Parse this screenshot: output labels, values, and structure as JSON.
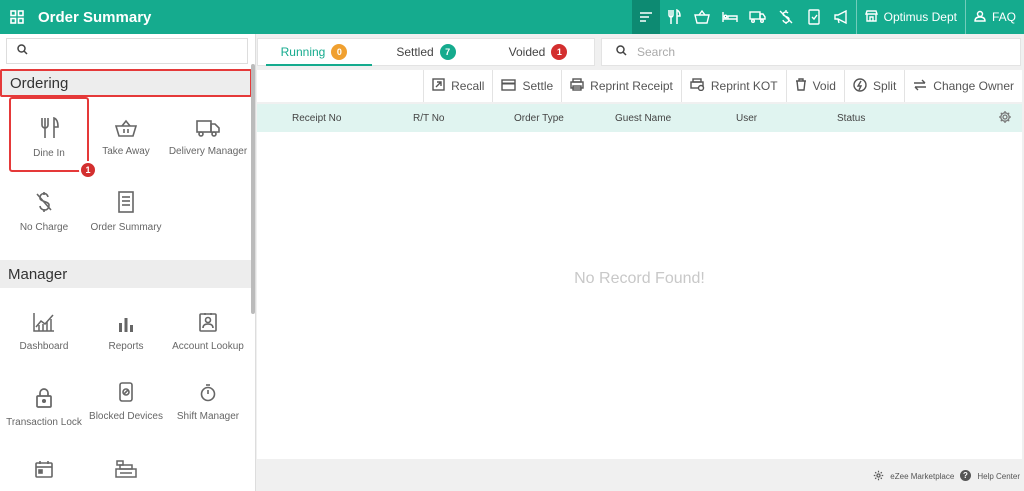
{
  "app": {
    "title": "Order Summary"
  },
  "topbar": {
    "icons": [
      "menu-lines-icon",
      "fork-knife-icon",
      "basket-icon",
      "bed-icon",
      "truck-icon",
      "no-charge-icon",
      "tablet-icon",
      "megaphone-icon"
    ],
    "department": "Optimus Dept",
    "faq": "FAQ"
  },
  "sidebar": {
    "search": {
      "placeholder": ""
    },
    "sections": [
      {
        "title": "Ordering",
        "tiles": [
          {
            "label": "Dine In",
            "icon": "fork-knife-icon",
            "badge": "1"
          },
          {
            "label": "Take Away",
            "icon": "basket-icon"
          },
          {
            "label": "Delivery Manager",
            "icon": "truck-icon"
          },
          {
            "label": "No Charge",
            "icon": "no-charge-icon"
          },
          {
            "label": "Order Summary",
            "icon": "receipt-icon"
          }
        ]
      },
      {
        "title": "Manager",
        "tiles": [
          {
            "label": "Dashboard",
            "icon": "chart-icon"
          },
          {
            "label": "Reports",
            "icon": "bar-chart-icon"
          },
          {
            "label": "Account Lookup",
            "icon": "contact-card-icon"
          },
          {
            "label": "Transaction Lock",
            "icon": "lock-icon"
          },
          {
            "label": "Blocked Devices",
            "icon": "blocked-device-icon"
          },
          {
            "label": "Shift Manager",
            "icon": "stopwatch-icon"
          }
        ]
      }
    ]
  },
  "tabs": [
    {
      "label": "Running",
      "count": "0",
      "color": "#f0a030"
    },
    {
      "label": "Settled",
      "count": "7",
      "color": "#15ab8e"
    },
    {
      "label": "Voided",
      "count": "1",
      "color": "#d32f2f"
    }
  ],
  "main_search": {
    "placeholder": "Search"
  },
  "toolbar": [
    {
      "label": "Recall",
      "icon": "recall-icon"
    },
    {
      "label": "Settle",
      "icon": "card-icon"
    },
    {
      "label": "Reprint Receipt",
      "icon": "printer-icon"
    },
    {
      "label": "Reprint KOT",
      "icon": "printer-kot-icon"
    },
    {
      "label": "Void",
      "icon": "trash-icon"
    },
    {
      "label": "Split",
      "icon": "split-icon"
    },
    {
      "label": "Change Owner",
      "icon": "swap-icon"
    }
  ],
  "table": {
    "columns": [
      "Receipt No",
      "R/T No",
      "Order Type",
      "Guest Name",
      "User",
      "Status"
    ],
    "empty_text": "No Record Found!"
  },
  "footer": {
    "marketplace": "eZee Marketplace",
    "help": "Help Center"
  },
  "colors": {
    "brand": "#15ab8e",
    "highlight": "#e53939"
  }
}
